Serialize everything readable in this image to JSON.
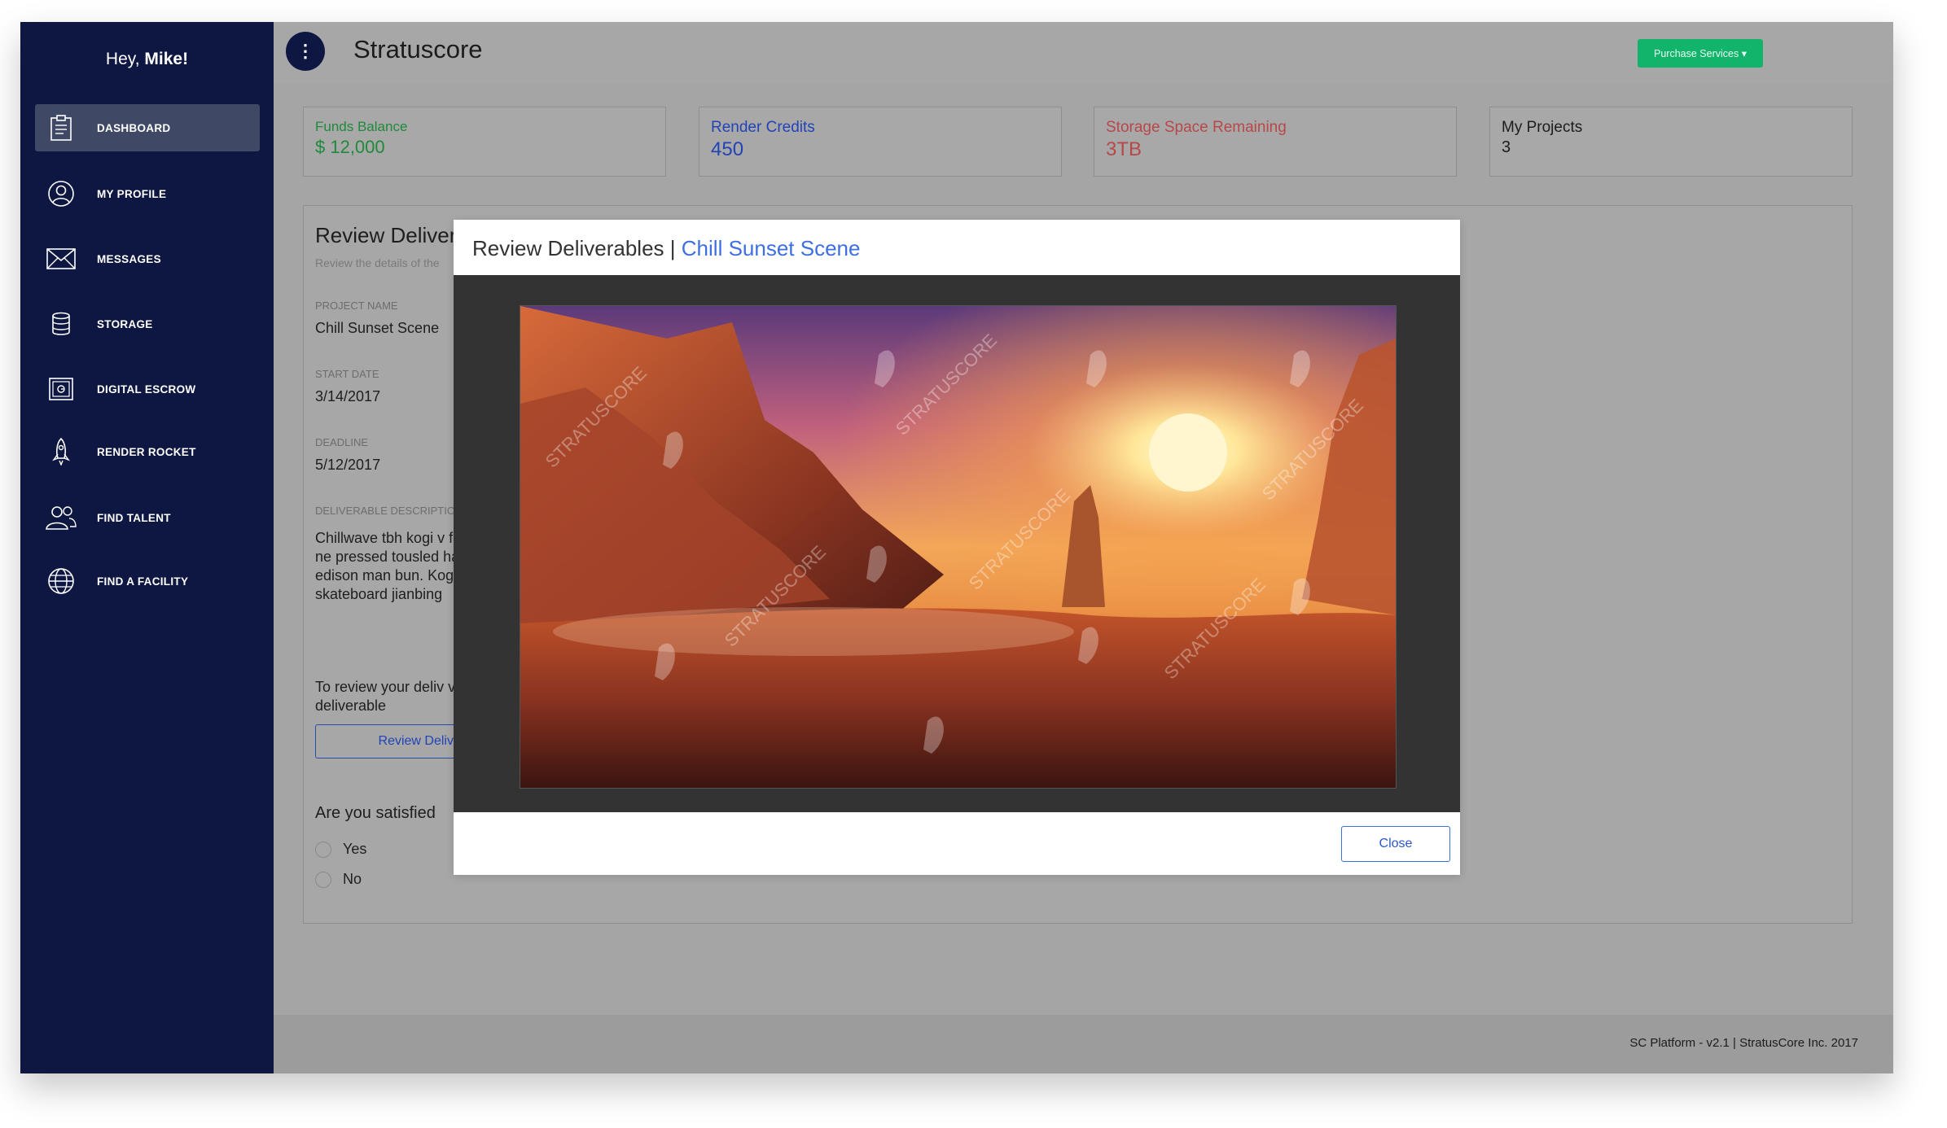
{
  "sidebar": {
    "greeting_prefix": "Hey,",
    "user_name": "Mike!",
    "items": [
      {
        "label": "DASHBOARD",
        "icon": "clipboard-icon"
      },
      {
        "label": "MY PROFILE",
        "icon": "user-icon"
      },
      {
        "label": "MESSAGES",
        "icon": "envelope-icon"
      },
      {
        "label": "STORAGE",
        "icon": "database-icon"
      },
      {
        "label": "DIGITAL ESCROW",
        "icon": "safe-icon"
      },
      {
        "label": "RENDER ROCKET",
        "icon": "rocket-icon"
      },
      {
        "label": "FIND TALENT",
        "icon": "users-icon"
      },
      {
        "label": "FIND A FACILITY",
        "icon": "globe-icon"
      }
    ]
  },
  "header": {
    "app_title": "Stratuscore",
    "purchase_label": "Purchase Services ▾"
  },
  "stats": [
    {
      "label": "Funds Balance",
      "value": "$ 12,000"
    },
    {
      "label": "Render Credits",
      "value": "450"
    },
    {
      "label": "Storage Space Remaining",
      "value": "3TB"
    },
    {
      "label": "My Projects",
      "value": "3"
    }
  ],
  "panel": {
    "title": "Review Deliverables",
    "subtitle": "Review the details of the",
    "project_name_label": "PROJECT NAME",
    "project_name": "Chill Sunset Scene",
    "start_date_label": "START DATE",
    "start_date": "3/14/2017",
    "deadline_label": "DEADLINE",
    "deadline": "5/12/2017",
    "description_label": "DELIVERABLE DESCRIPTION",
    "description": "Chillwave tbh kogi v four dollar toast, ne pressed tousled har Mumblecore edison man bun. Kogi synth skateboard jianbing",
    "review_note": "To review your deliv view the deliverable",
    "review_button": "Review Deliverables",
    "question": "Are you satisfied",
    "options": [
      "Yes",
      "No"
    ]
  },
  "modal": {
    "title": "Review Deliverables",
    "separator": "|",
    "project": "Chill Sunset Scene",
    "watermark": "STRATUSCORE",
    "close_label": "Close"
  },
  "footer": {
    "text": "SC Platform - v2.1 | StratusCore Inc. 2017"
  },
  "colors": {
    "sidebar": "#0e1741",
    "accent_green": "#12b36b",
    "funds": "#1f8a3a",
    "credits": "#2143b7",
    "storage": "#b8474a",
    "link_blue": "#3d6fe0"
  }
}
